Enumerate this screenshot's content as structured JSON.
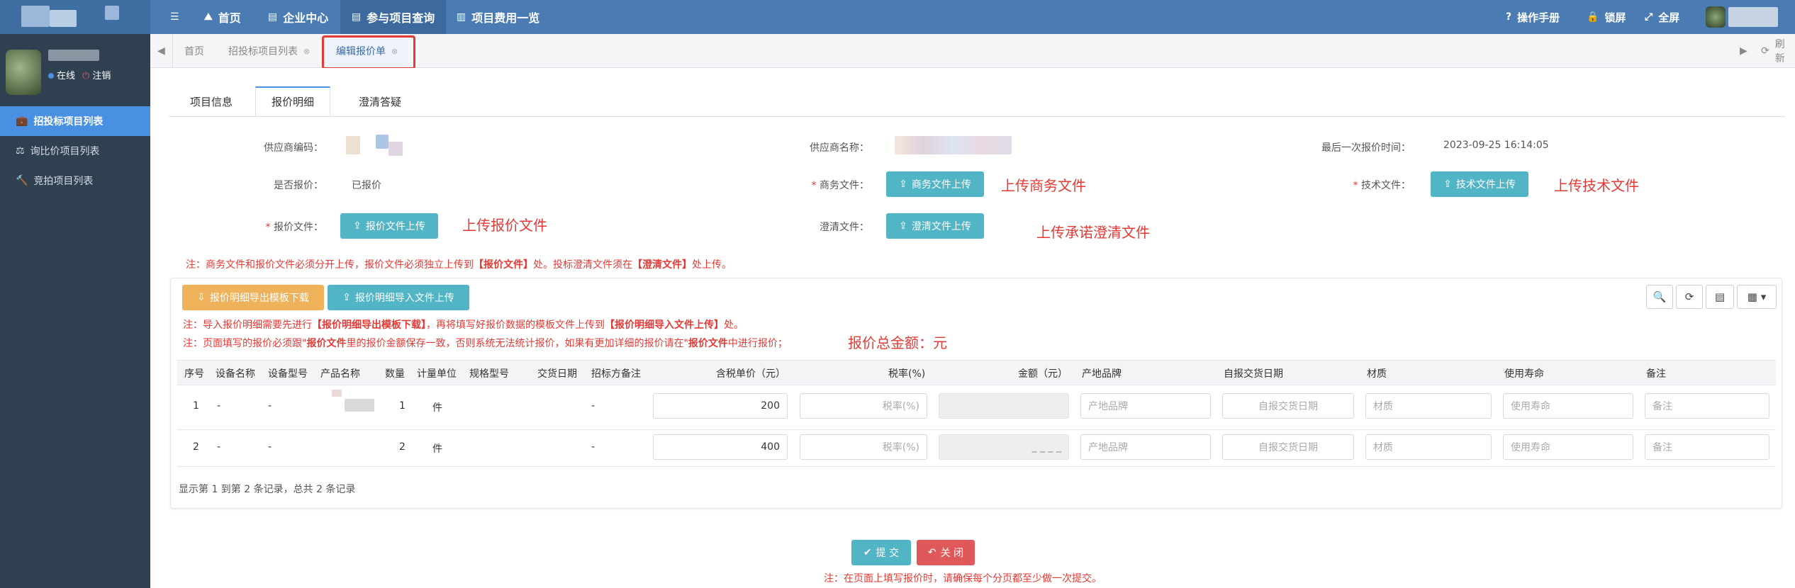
{
  "topnav": {
    "items": [
      {
        "icon": "☰",
        "label": ""
      },
      {
        "icon": "⛰",
        "label": "首页"
      },
      {
        "icon": "▤",
        "label": "企业中心"
      },
      {
        "icon": "▤",
        "label": "参与项目查询"
      },
      {
        "icon": "▥",
        "label": "项目费用一览"
      }
    ],
    "right": [
      {
        "icon": "?",
        "label": "操作手册"
      },
      {
        "icon": "🔒",
        "label": "锁屏"
      },
      {
        "icon": "⤢",
        "label": "全屏"
      }
    ]
  },
  "sidebar": {
    "status_online": "在线",
    "logout": "注销",
    "items": [
      {
        "icon": "💼",
        "label": "招投标项目列表"
      },
      {
        "icon": "⚖",
        "label": "询比价项目列表"
      },
      {
        "icon": "🔨",
        "label": "竞拍项目列表"
      }
    ]
  },
  "tabs": {
    "items": [
      {
        "label": "首页"
      },
      {
        "label": "招投标项目列表"
      },
      {
        "label": "编辑报价单"
      }
    ],
    "refresh": "刷新"
  },
  "subtabs": [
    "项目信息",
    "报价明细",
    "澄清答疑"
  ],
  "form": {
    "supplier_code_label": "供应商编码：",
    "supplier_name_label": "供应商名称：",
    "last_quote_label": "最后一次报价时间：",
    "last_quote_value": "2023-09-25 16:14:05",
    "quoted_label": "是否报价：",
    "quoted_value": "已报价",
    "biz_file_label": "商务文件：",
    "biz_upload": "商务文件上传",
    "tech_file_label": "技术文件：",
    "tech_upload": "技术文件上传",
    "price_file_label": "报价文件：",
    "price_upload": "报价文件上传",
    "clarify_label": "澄清文件：",
    "clarify_upload": "澄清文件上传",
    "anno_biz": "上传商务文件",
    "anno_tech": "上传技术文件",
    "anno_price": "上传报价文件",
    "anno_clarify": "上传承诺澄清文件"
  },
  "notes": {
    "n1a": "注：商务文件和报价文件必须分开上传，报价文件必须独立上传到",
    "n1b": "【报价文件】",
    "n1c": "处。投标澄清文件须在",
    "n1d": "【澄清文件】",
    "n1e": "处上传。",
    "n2a": "注：导入报价明细需要先进行",
    "n2b": "【报价明细导出模板下载】",
    "n2c": "，再将填写好报价数据的模板文件上传到",
    "n2d": "【报价明细导入文件上传】",
    "n2e": "处。",
    "n3a": "注：页面填写的报价必须跟\"",
    "n3b": "报价文件",
    "n3c": "里的报价金额保存一致，否则系统无法统计报价，如果有更加详细的报价请在\"",
    "n3d": "报价文件",
    "n3e": "中进行报价；",
    "total": "报价总金额：元",
    "bottom": "注：在页面上填写报价时，请确保每个分页都至少做一次提交。"
  },
  "toolbar": {
    "export": "报价明细导出模板下载",
    "import": "报价明细导入文件上传"
  },
  "table": {
    "headers": [
      "序号",
      "设备名称",
      "设备型号",
      "产品名称",
      "数量",
      "计量单位",
      "规格型号",
      "交货日期",
      "招标方备注",
      "含税单价（元）",
      "税率(%)",
      "金额（元）",
      "产地品牌",
      "自报交货日期",
      "材质",
      "使用寿命",
      "备注"
    ],
    "rows": [
      {
        "no": "1",
        "equip": "-",
        "model": "-",
        "qty": "1",
        "unit": "件",
        "remark": "-",
        "price": "200",
        "amount": ""
      },
      {
        "no": "2",
        "equip": "-",
        "model": "-",
        "qty": "2",
        "unit": "件",
        "remark": "-",
        "price": "400",
        "amount": "_ _ _ _"
      }
    ],
    "placeholders": {
      "tax": "税率(%)",
      "origin": "产地品牌",
      "date": "自报交货日期",
      "material": "材质",
      "life": "使用寿命",
      "note": "备注"
    },
    "footer": "显示第 1 到第 2 条记录，总共 2 条记录"
  },
  "actions": {
    "submit": "提 交",
    "close": "关 闭"
  },
  "colors": {
    "topbar": "#4a7bb3",
    "sidebar": "#2f4050",
    "accent": "#4a90e2",
    "teal": "#52b5c5",
    "orange": "#eeb25a",
    "danger": "#e0595a",
    "note_red": "#e53935"
  }
}
